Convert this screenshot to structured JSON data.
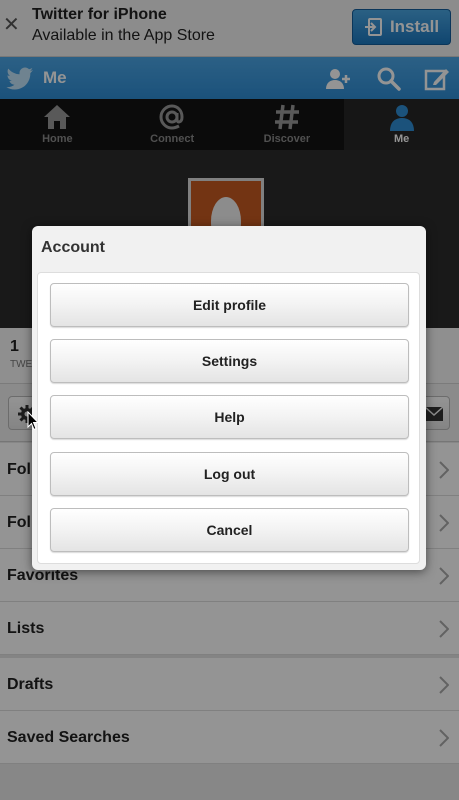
{
  "banner": {
    "close_glyph": "✕",
    "title": "Twitter for iPhone",
    "subtitle": "Available in the App Store",
    "install_label": "Install"
  },
  "header": {
    "title": "Me",
    "icons": [
      "twitter-bird-icon",
      "add-user-icon",
      "search-icon",
      "compose-icon"
    ],
    "accent": "#2f8dd4"
  },
  "tabs": [
    {
      "label": "Home",
      "icon": "home-icon"
    },
    {
      "label": "Connect",
      "icon": "at-icon"
    },
    {
      "label": "Discover",
      "icon": "hashtag-icon"
    },
    {
      "label": "Me",
      "icon": "person-icon",
      "active": true
    }
  ],
  "stats": {
    "tweets_count": "1",
    "tweets_label": "TWE"
  },
  "list": {
    "items": [
      {
        "label": "Foll"
      },
      {
        "label": "Foll"
      },
      {
        "label": "Favorites"
      },
      {
        "label": "Lists"
      },
      {
        "label": "Drafts"
      },
      {
        "label": "Saved Searches"
      }
    ]
  },
  "modal": {
    "title": "Account",
    "buttons": {
      "edit_profile": "Edit profile",
      "settings": "Settings",
      "help": "Help",
      "log_out": "Log out",
      "cancel": "Cancel"
    }
  }
}
